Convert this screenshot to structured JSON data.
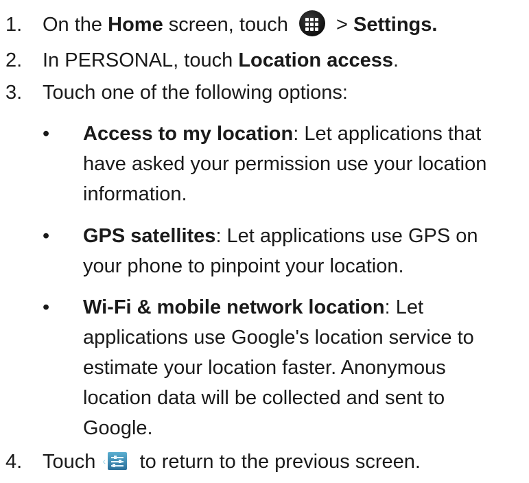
{
  "steps": [
    {
      "number": "1.",
      "parts": {
        "a": "On the ",
        "b": "Home",
        "c": " screen, touch ",
        "d": " > ",
        "e": "Settings."
      },
      "icon": "apps-launcher-icon"
    },
    {
      "number": "2.",
      "parts": {
        "a": "In PERSONAL, touch ",
        "b": "Location access",
        "c": "."
      }
    },
    {
      "number": "3.",
      "text": "Touch one of the following options:"
    },
    {
      "number": "4.",
      "parts": {
        "a": "Touch ",
        "b": " to return to the previous screen."
      },
      "icon": "back-settings-icon"
    }
  ],
  "options": [
    {
      "bullet": "•",
      "title": "Access to my location",
      "line1": ": Let applications that",
      "line2": "have asked your permission use your location",
      "line3": "information."
    },
    {
      "bullet": "•",
      "title": "GPS satellites",
      "line1": ": Let applications use GPS on",
      "line2": "your phone to pinpoint your location."
    },
    {
      "bullet": "•",
      "title": "Wi-Fi & mobile network location",
      "line1": ": Let",
      "line2": "applications use Google's location service to",
      "line3": "estimate your location faster. Anonymous",
      "line4": "location data will be collected and sent to",
      "line5": "Google."
    }
  ]
}
